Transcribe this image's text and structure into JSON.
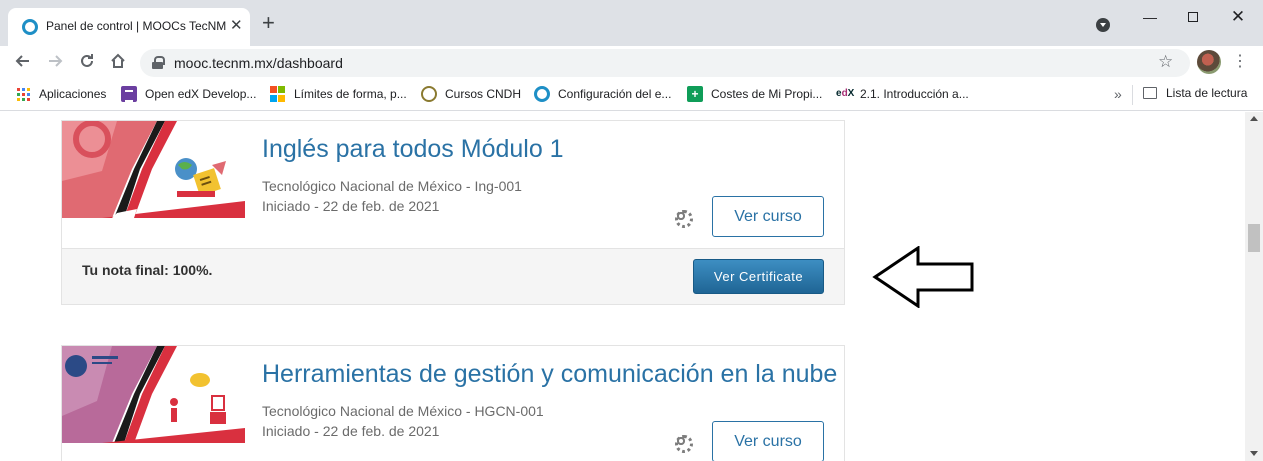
{
  "browser": {
    "tab_title": "Panel de control | MOOCs TecNM",
    "tab_close": "✕",
    "new_tab": "+",
    "url": "mooc.tecnm.mx/dashboard",
    "window_min": "—",
    "window_close": "✕"
  },
  "bookmarks": {
    "items": [
      {
        "label": "Aplicaciones",
        "icon": "apps-grid-icon"
      },
      {
        "label": "Open edX Develop...",
        "icon": "openedx-icon"
      },
      {
        "label": "Límites de forma, p...",
        "icon": "microsoft-icon"
      },
      {
        "label": "Cursos CNDH",
        "icon": "cndh-icon"
      },
      {
        "label": "Configuración del e...",
        "icon": "ring-icon"
      },
      {
        "label": "Costes de Mi Propi...",
        "icon": "sheets-icon"
      },
      {
        "label": "2.1. Introducción a...",
        "icon": "edx-icon"
      }
    ],
    "overflow": "»",
    "reading_list": "Lista de lectura"
  },
  "courses": [
    {
      "title": "Inglés para todos Módulo 1",
      "org": "Tecnológico Nacional de México - Ing-001",
      "started": "Iniciado - 22 de feb. de 2021",
      "view_button": "Ver curso",
      "final_grade": "Tu nota final: 100%.",
      "certificate_button": "Ver Certificate"
    },
    {
      "title": "Herramientas de gestión y comunicación en la nube",
      "org": "Tecnológico Nacional de México - HGCN-001",
      "started": "Iniciado - 22 de feb. de 2021",
      "view_button": "Ver curso"
    }
  ],
  "colors": {
    "link_blue": "#2a72a5",
    "certificate_button": "#2a76a9",
    "thumb_red": "#d9303f"
  }
}
